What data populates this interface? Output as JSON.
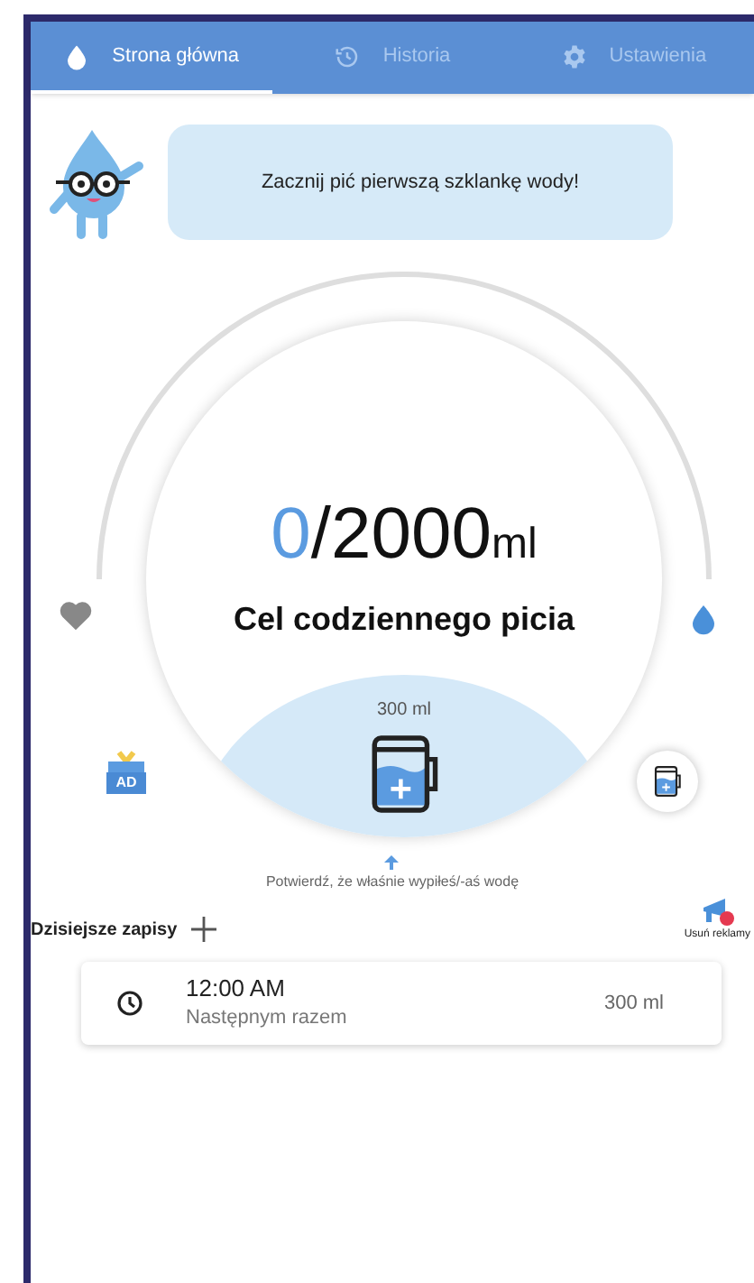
{
  "tabs": [
    {
      "label": "Strona główna",
      "selected": true
    },
    {
      "label": "Historia",
      "selected": false
    },
    {
      "label": "Ustawienia",
      "selected": false
    }
  ],
  "mascot": {
    "message": "Zacznij pić pierwszą szklankę wody!"
  },
  "progress": {
    "current": "0",
    "goal": "/2000",
    "unit": "ml",
    "caption": "Cel codziennego picia"
  },
  "cup": {
    "volume": "300 ml"
  },
  "ad_badge": "AD",
  "hint": "Potwierdź, że właśnie wypiłeś/-aś wodę",
  "records": {
    "title": "Dzisiejsze zapisy",
    "remove_ads": "Usuń reklamy",
    "items": [
      {
        "time": "12:00 AM",
        "note": "Następnym razem",
        "volume": "300 ml"
      }
    ]
  }
}
